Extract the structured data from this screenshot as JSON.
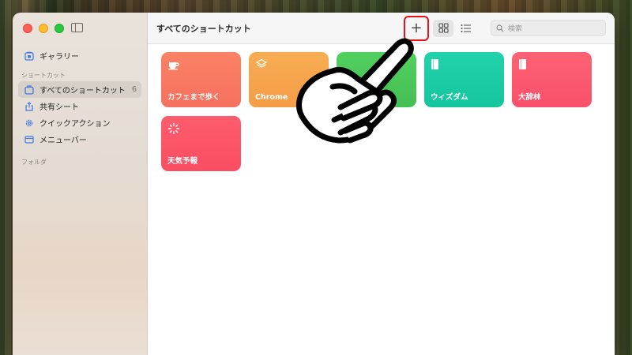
{
  "app": {
    "title": "すべてのショートカット"
  },
  "sidebar": {
    "gallery": "ギャラリー",
    "section_shortcuts": "ショートカット",
    "items": [
      {
        "label": "すべてのショートカット",
        "count": "6",
        "icon": "all-shortcuts-icon"
      },
      {
        "label": "共有シート",
        "icon": "share-icon"
      },
      {
        "label": "クイックアクション",
        "icon": "gear-icon"
      },
      {
        "label": "メニューバー",
        "icon": "menubar-icon"
      }
    ],
    "section_folders": "フォルダ"
  },
  "toolbar": {
    "add_label": "+",
    "search_placeholder": "検索"
  },
  "shortcuts": [
    {
      "label": "カフェまで歩く",
      "color": "#f87a61",
      "icon": "cup-icon"
    },
    {
      "label": "Chrome",
      "color": "#f6a54c",
      "icon": "layers-icon"
    },
    {
      "label": "",
      "color": "#4cc85c",
      "icon": "unknown-icon"
    },
    {
      "label": "ウィズダム",
      "color": "#1fcaa5",
      "icon": "book-icon"
    },
    {
      "label": "大辞林",
      "color": "#fb5970",
      "icon": "book-icon"
    },
    {
      "label": "天気予報",
      "color": "#fc5467",
      "icon": "spinner-icon"
    }
  ]
}
